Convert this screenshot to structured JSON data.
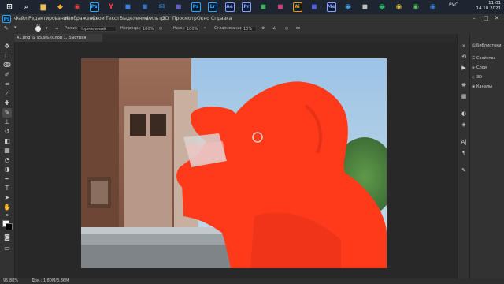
{
  "taskbar": {
    "apps": [
      {
        "name": "start-icon",
        "color": "#ffffff",
        "glyph": "⊞"
      },
      {
        "name": "search-icon",
        "color": "#cccccc",
        "glyph": "⌕"
      },
      {
        "name": "files-icon",
        "color": "#e8c060",
        "glyph": "▆"
      },
      {
        "name": "app-icon",
        "color": "#f0b030",
        "glyph": "◆"
      },
      {
        "name": "chrome-icon",
        "color": "#e04040",
        "glyph": "◉"
      },
      {
        "name": "photoshop-taskbar-icon",
        "color": "#31a8ff",
        "glyph": "Ps"
      },
      {
        "name": "yandex-icon",
        "color": "#ff4040",
        "glyph": "Y"
      },
      {
        "name": "app-icon",
        "color": "#4080e0",
        "glyph": "◼"
      },
      {
        "name": "app-icon",
        "color": "#4070c0",
        "glyph": "◼"
      },
      {
        "name": "mail-icon",
        "color": "#3090e0",
        "glyph": "✉"
      },
      {
        "name": "app-icon",
        "color": "#6060c0",
        "glyph": "◼"
      },
      {
        "name": "photoshop-icon",
        "color": "#31a8ff",
        "glyph": "Ps"
      },
      {
        "name": "lightroom-icon",
        "color": "#31a8ff",
        "glyph": "Lr"
      },
      {
        "name": "after-effects-icon",
        "color": "#9999ff",
        "glyph": "Ae"
      },
      {
        "name": "premiere-icon",
        "color": "#9999ff",
        "glyph": "Pr"
      },
      {
        "name": "app-icon",
        "color": "#40b060",
        "glyph": "◼"
      },
      {
        "name": "app-icon",
        "color": "#d04080",
        "glyph": "◼"
      },
      {
        "name": "illustrator-icon",
        "color": "#ff9a00",
        "glyph": "Ai"
      },
      {
        "name": "app-icon",
        "color": "#5060e0",
        "glyph": "◼"
      },
      {
        "name": "media-encoder-icon",
        "color": "#9999ff",
        "glyph": "Me"
      },
      {
        "name": "app-icon",
        "color": "#40a0e0",
        "glyph": "◉"
      },
      {
        "name": "app-icon",
        "color": "#c0c0c0",
        "glyph": "◼"
      },
      {
        "name": "app-icon",
        "color": "#20c060",
        "glyph": "◉"
      },
      {
        "name": "app-icon",
        "color": "#e0c040",
        "glyph": "◉"
      },
      {
        "name": "app-icon",
        "color": "#60c060",
        "glyph": "◉"
      },
      {
        "name": "app-icon",
        "color": "#4080e0",
        "glyph": "◉"
      }
    ],
    "lang": "РУС",
    "time": "11:01",
    "date": "14.10.2021"
  },
  "menubar": {
    "logo": "Ps",
    "items": [
      "Файл",
      "Редактирование",
      "Изображение",
      "Слои",
      "Текст",
      "Выделение",
      "Фильтр",
      "3D",
      "Просмотр",
      "Окно",
      "Справка"
    ]
  },
  "options": {
    "mode_label": "Режим:",
    "mode_value": "Нормальный",
    "opacity_label": "Непрозр.:",
    "opacity_value": "100%",
    "press_label": "Наж.:",
    "press_value": "100%",
    "smoothing_label": "Сглаживание:",
    "smoothing_value": "10%",
    "brush_size": "40"
  },
  "document": {
    "tab": "41.png @ 95,9% (Слой 1, Быстрая маска/8) *"
  },
  "panel": {
    "items": [
      {
        "label": "Библиотеки",
        "icon": "▤"
      },
      {
        "label": "Свойства",
        "icon": "☰"
      },
      {
        "label": "Слои",
        "icon": "◈"
      },
      {
        "label": "3D",
        "icon": "◇"
      },
      {
        "label": "Каналы",
        "icon": "◉"
      }
    ]
  },
  "status": {
    "zoom": "95,88%",
    "doc": "Док.: 1,80М/3,86М"
  },
  "colors": {
    "mask": "#ff3a1a",
    "accent": "#31a8ff"
  }
}
